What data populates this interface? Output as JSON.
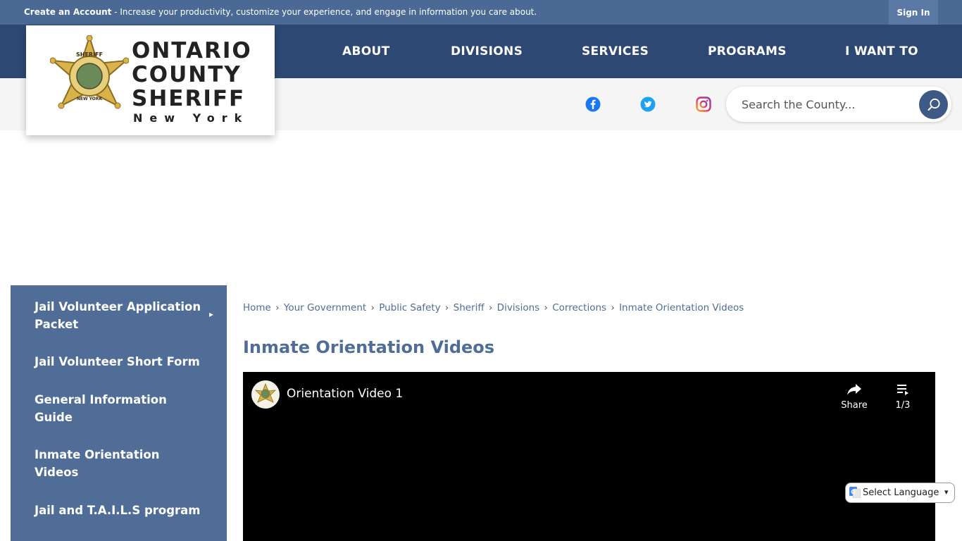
{
  "topbar": {
    "create_label": "Create an Account",
    "create_text": " - Increase your productivity, customize your experience, and engage in information you care about.",
    "signin_label": "Sign In"
  },
  "logo": {
    "line1": "ONTARIO",
    "line2": "COUNTY",
    "line3": "SHERIFF",
    "line4": "New York",
    "badge_top": "SHERIFF",
    "badge_ring": "ONTARIO COUNTY",
    "badge_bottom": "NEW YORK"
  },
  "nav": {
    "items": [
      {
        "label": "ABOUT"
      },
      {
        "label": "DIVISIONS"
      },
      {
        "label": "SERVICES"
      },
      {
        "label": "PROGRAMS"
      },
      {
        "label": "I WANT TO"
      }
    ]
  },
  "social": {
    "facebook_icon": "facebook-icon",
    "twitter_icon": "twitter-icon",
    "instagram_icon": "instagram-icon",
    "colors": {
      "facebook": "#1877f2",
      "twitter": "#1da1f2",
      "instagram": "#e1306c"
    }
  },
  "search": {
    "placeholder": "Search the County...",
    "icon": "search-icon"
  },
  "sidebar": {
    "items": [
      {
        "label": "Jail Volunteer Application Packet"
      },
      {
        "label": "Jail Volunteer Short Form"
      },
      {
        "label": "General Information Guide"
      },
      {
        "label": "Inmate Orientation Videos"
      },
      {
        "label": "Jail and T.A.I.L.S program"
      }
    ],
    "arrow": "▸"
  },
  "breadcrumb": {
    "items": [
      "Home",
      "Your Government",
      "Public Safety",
      "Sheriff",
      "Divisions",
      "Corrections"
    ],
    "current": "Inmate Orientation Videos",
    "separator": "›"
  },
  "page": {
    "title": "Inmate Orientation Videos"
  },
  "video": {
    "title": "Orientation Video 1",
    "share_label": "Share",
    "playlist_count": "1/3"
  },
  "language": {
    "label": "Select Language"
  },
  "colors": {
    "topbar": "#4a6a95",
    "navbar": "#2d4873",
    "accent": "#4f6d96",
    "band": "#f5f5f5"
  }
}
